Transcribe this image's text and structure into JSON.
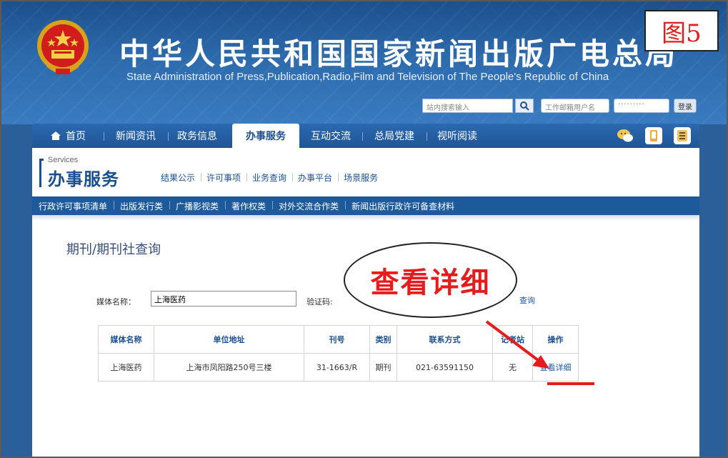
{
  "figure_label": "图5",
  "header": {
    "title": "中华人民共和国国家新闻出版广电总局",
    "subtitle": "State Administration of Press,Publication,Radio,Film and Television of The People's Republic of China",
    "search_placeholder": "站内搜索输入",
    "user_placeholder": "工作邮箱用户名",
    "password_mask": "·········",
    "login_label": "登录"
  },
  "nav": {
    "items": [
      {
        "label": "首页",
        "icon": "home-icon"
      },
      {
        "label": "新闻资讯"
      },
      {
        "label": "政务信息"
      },
      {
        "label": "办事服务",
        "active": true
      },
      {
        "label": "互动交流"
      },
      {
        "label": "总局党建"
      },
      {
        "label": "视听阅读"
      }
    ]
  },
  "service": {
    "en": "Services",
    "cn": "办事服务",
    "tabs": [
      "结果公示",
      "许可事项",
      "业务查询",
      "办事平台",
      "场景服务"
    ]
  },
  "subnav": {
    "items": [
      "行政许可事项清单",
      "出版发行类",
      "广播影视类",
      "著作权类",
      "对外交流合作类",
      "新闻出版行政许可备查材料"
    ]
  },
  "page": {
    "title": "期刊/期刊社查询",
    "media_label": "媒体名称：",
    "media_value": "上海医药",
    "captcha_label": "验证码:",
    "query_label": "查询"
  },
  "callout": {
    "text": "查看详细"
  },
  "table": {
    "headers": [
      "媒体名称",
      "单位地址",
      "刊号",
      "类别",
      "联系方式",
      "记者站",
      "操作"
    ],
    "rows": [
      [
        "上海医药",
        "上海市凤阳路250号三楼",
        "31-1663/R",
        "期刊",
        "021-63591150",
        "无",
        "查看详细"
      ]
    ]
  },
  "colors": {
    "brand_blue": "#1f5596",
    "accent_red": "#e61c1c"
  }
}
